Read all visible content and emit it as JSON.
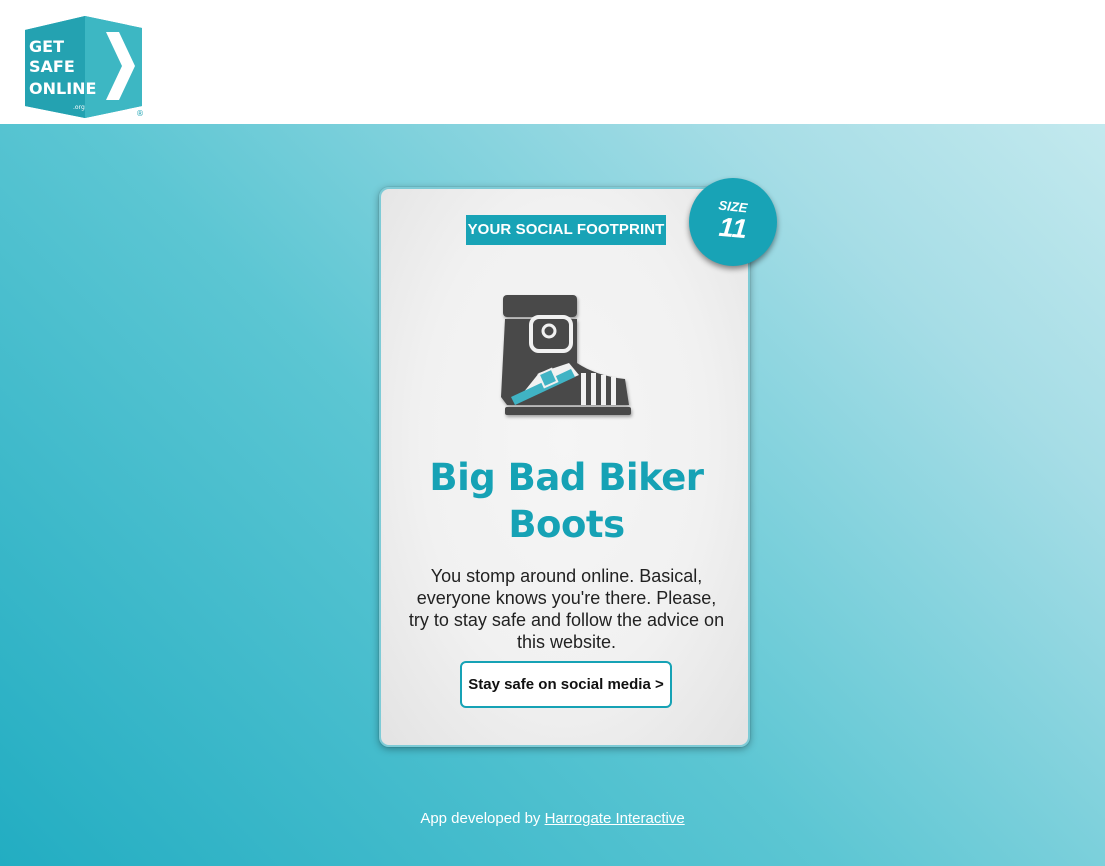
{
  "header": {
    "logo": {
      "icon": "get-safe-online-logo",
      "line1": "GET",
      "line2": "SAFE",
      "line3": "ONLINE",
      "suffix": ".org",
      "registered": "®"
    }
  },
  "card": {
    "tag": "YOUR SOCIAL FOOTPRINT",
    "badge": {
      "label": "SIZE",
      "value": "11"
    },
    "image_icon": "biker-boot-icon",
    "title": "Big Bad Biker Boots",
    "description": "You stomp around online. Basical, everyone knows you're there. Please, try to stay safe and follow the advice on this website.",
    "cta_label": "Stay safe on social media >"
  },
  "footer": {
    "prefix": "App developed by ",
    "link_text": "Harrogate Interactive"
  },
  "colors": {
    "brand_teal": "#18a3b6",
    "title_teal": "#16a2b5",
    "background_start": "#22adc2",
    "background_end": "#c3e9ee",
    "card_background": "#f1f1f1"
  }
}
